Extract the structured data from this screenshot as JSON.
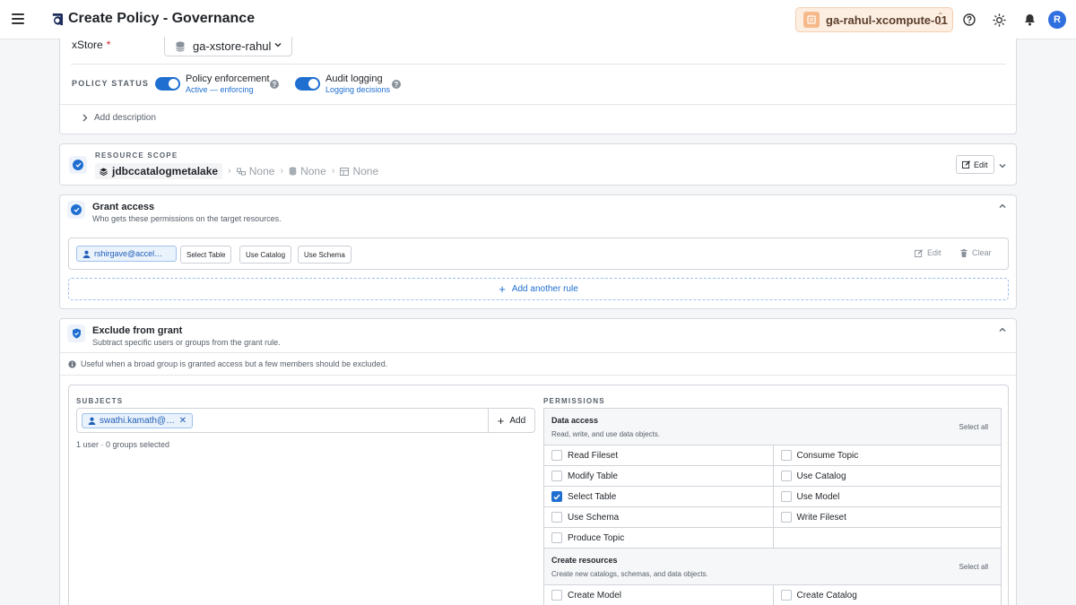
{
  "header": {
    "title": "Create Policy - Governance",
    "workspace": "ga-rahul-xcompute-01",
    "avatar_initial": "R"
  },
  "basics": {
    "xstore_label": "xStore",
    "required_mark": "*",
    "xstore_value": "ga-xstore-rahul",
    "policy_status_label": "POLICY STATUS",
    "enforcement_title": "Policy enforcement",
    "enforcement_sub": "Active — enforcing",
    "audit_title": "Audit logging",
    "audit_sub": "Logging decisions",
    "help_glyph": "?",
    "add_description": "Add description"
  },
  "scope": {
    "label": "RESOURCE SCOPE",
    "root": "jdbccatalogmetalake",
    "levels": [
      "None",
      "None",
      "None"
    ],
    "edit_label": "Edit"
  },
  "grant": {
    "title": "Grant access",
    "subtitle": "Who gets these permissions on the target resources.",
    "subject": "rshirgave@accel…",
    "permissions": [
      "Select Table",
      "Use Catalog",
      "Use Schema"
    ],
    "edit_label": "Edit",
    "clear_label": "Clear",
    "add_rule": "Add another rule"
  },
  "exclude": {
    "title": "Exclude from grant",
    "subtitle": "Subtract specific users or groups from the grant rule.",
    "info": "Useful when a broad group is granted access but a few members should be excluded.",
    "subjects_label": "SUBJECTS",
    "permissions_label": "PERMISSIONS",
    "subject_chip": "swathi.kamath@…",
    "add_label": "Add",
    "count_text": "1 user · 0 groups selected",
    "groups": [
      {
        "title": "Data access",
        "subtitle": "Read, write, and use data objects.",
        "select_all": "Select all",
        "rows": [
          [
            {
              "label": "Read Fileset",
              "checked": false
            },
            {
              "label": "Consume Topic",
              "checked": false
            }
          ],
          [
            {
              "label": "Modify Table",
              "checked": false
            },
            {
              "label": "Use Catalog",
              "checked": false
            }
          ],
          [
            {
              "label": "Select Table",
              "checked": true
            },
            {
              "label": "Use Model",
              "checked": false
            }
          ],
          [
            {
              "label": "Use Schema",
              "checked": false
            },
            {
              "label": "Write Fileset",
              "checked": false
            }
          ],
          [
            {
              "label": "Produce Topic",
              "checked": false
            },
            null
          ]
        ]
      },
      {
        "title": "Create resources",
        "subtitle": "Create new catalogs, schemas, and data objects.",
        "select_all": "Select all",
        "rows": [
          [
            {
              "label": "Create Model",
              "checked": false
            },
            {
              "label": "Create Catalog",
              "checked": false
            }
          ]
        ]
      }
    ]
  },
  "colors": {
    "accent": "#1f6fd1",
    "chip_bg": "#eaf2fc",
    "workspace_bg": "#fdeee2"
  }
}
